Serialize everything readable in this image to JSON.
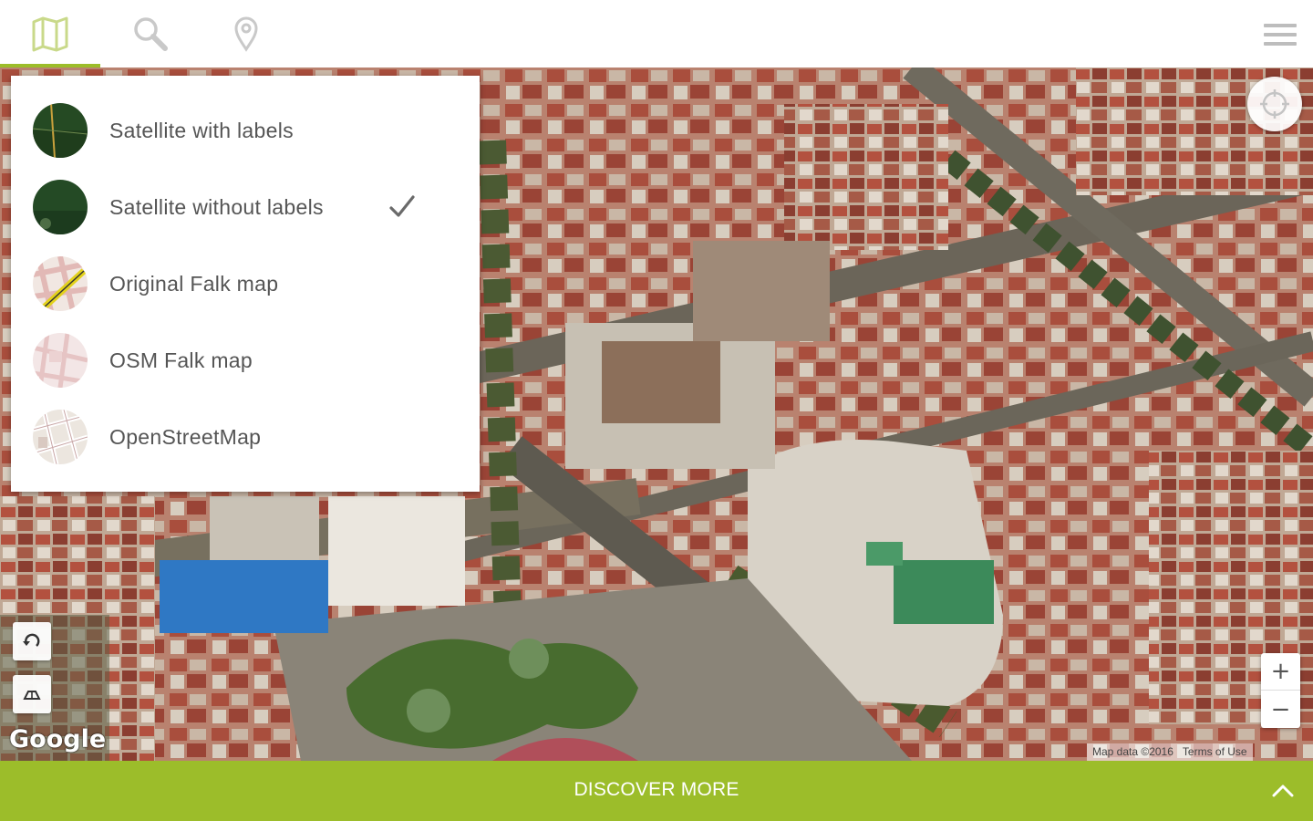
{
  "toolbar": {
    "tabs": [
      {
        "icon": "map-icon",
        "active": true
      },
      {
        "icon": "search-icon",
        "active": false
      },
      {
        "icon": "location-pin-icon",
        "active": false
      }
    ],
    "menu_icon": "hamburger-menu-icon"
  },
  "layer_menu": {
    "items": [
      {
        "label": "Satellite with labels",
        "selected": false
      },
      {
        "label": "Satellite without labels",
        "selected": true
      },
      {
        "label": "Original Falk map",
        "selected": false
      },
      {
        "label": "OSM Falk map",
        "selected": false
      },
      {
        "label": "OpenStreetMap",
        "selected": false
      }
    ]
  },
  "map": {
    "logo": "Google",
    "attribution": "Map data ©2016",
    "terms": "Terms of Use",
    "zoom_in": "+",
    "zoom_out": "−"
  },
  "bottom_bar": {
    "label": "DISCOVER MORE",
    "icon": "chevron-up-icon"
  },
  "colors": {
    "accent": "#9cbd2a",
    "menu_text": "#555555",
    "toolbar_icon": "#c9d98a"
  }
}
